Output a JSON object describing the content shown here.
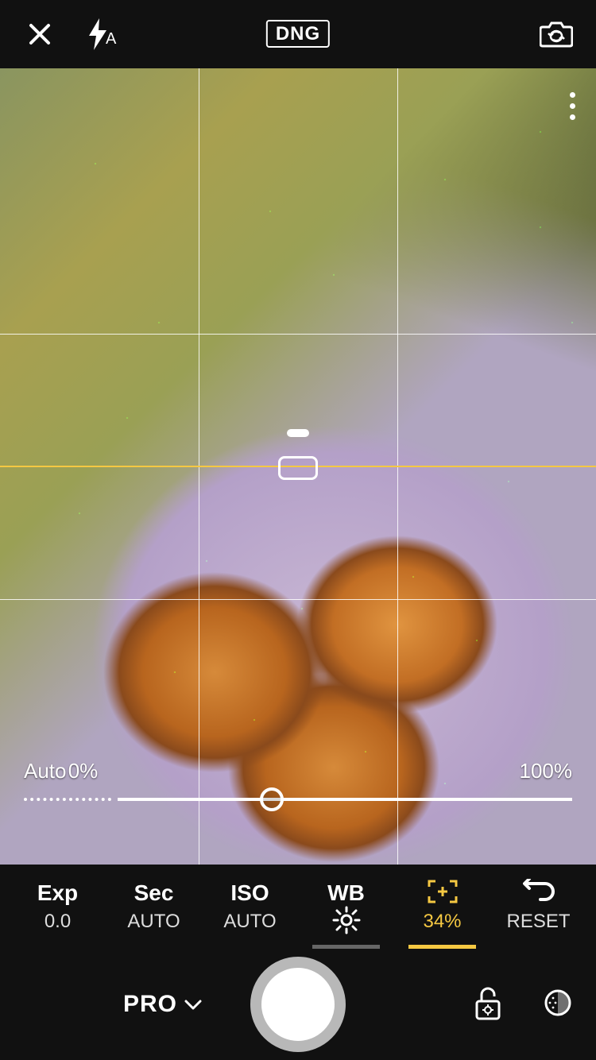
{
  "topbar": {
    "format_badge": "DNG",
    "flash_mode": "A"
  },
  "viewfinder": {
    "slider": {
      "auto_label": "Auto",
      "min_label": "0%",
      "max_label": "100%",
      "position_percent": 34
    }
  },
  "params": {
    "exp": {
      "label": "Exp",
      "value": "0.0"
    },
    "sec": {
      "label": "Sec",
      "value": "AUTO"
    },
    "iso": {
      "label": "ISO",
      "value": "AUTO"
    },
    "wb": {
      "label": "WB"
    },
    "focus": {
      "icon": "[+]",
      "value": "34%"
    },
    "reset": {
      "label": "RESET"
    }
  },
  "bottombar": {
    "mode_label": "PRO"
  },
  "colors": {
    "accent": "#f5c842",
    "peaking": "#00ff00"
  }
}
